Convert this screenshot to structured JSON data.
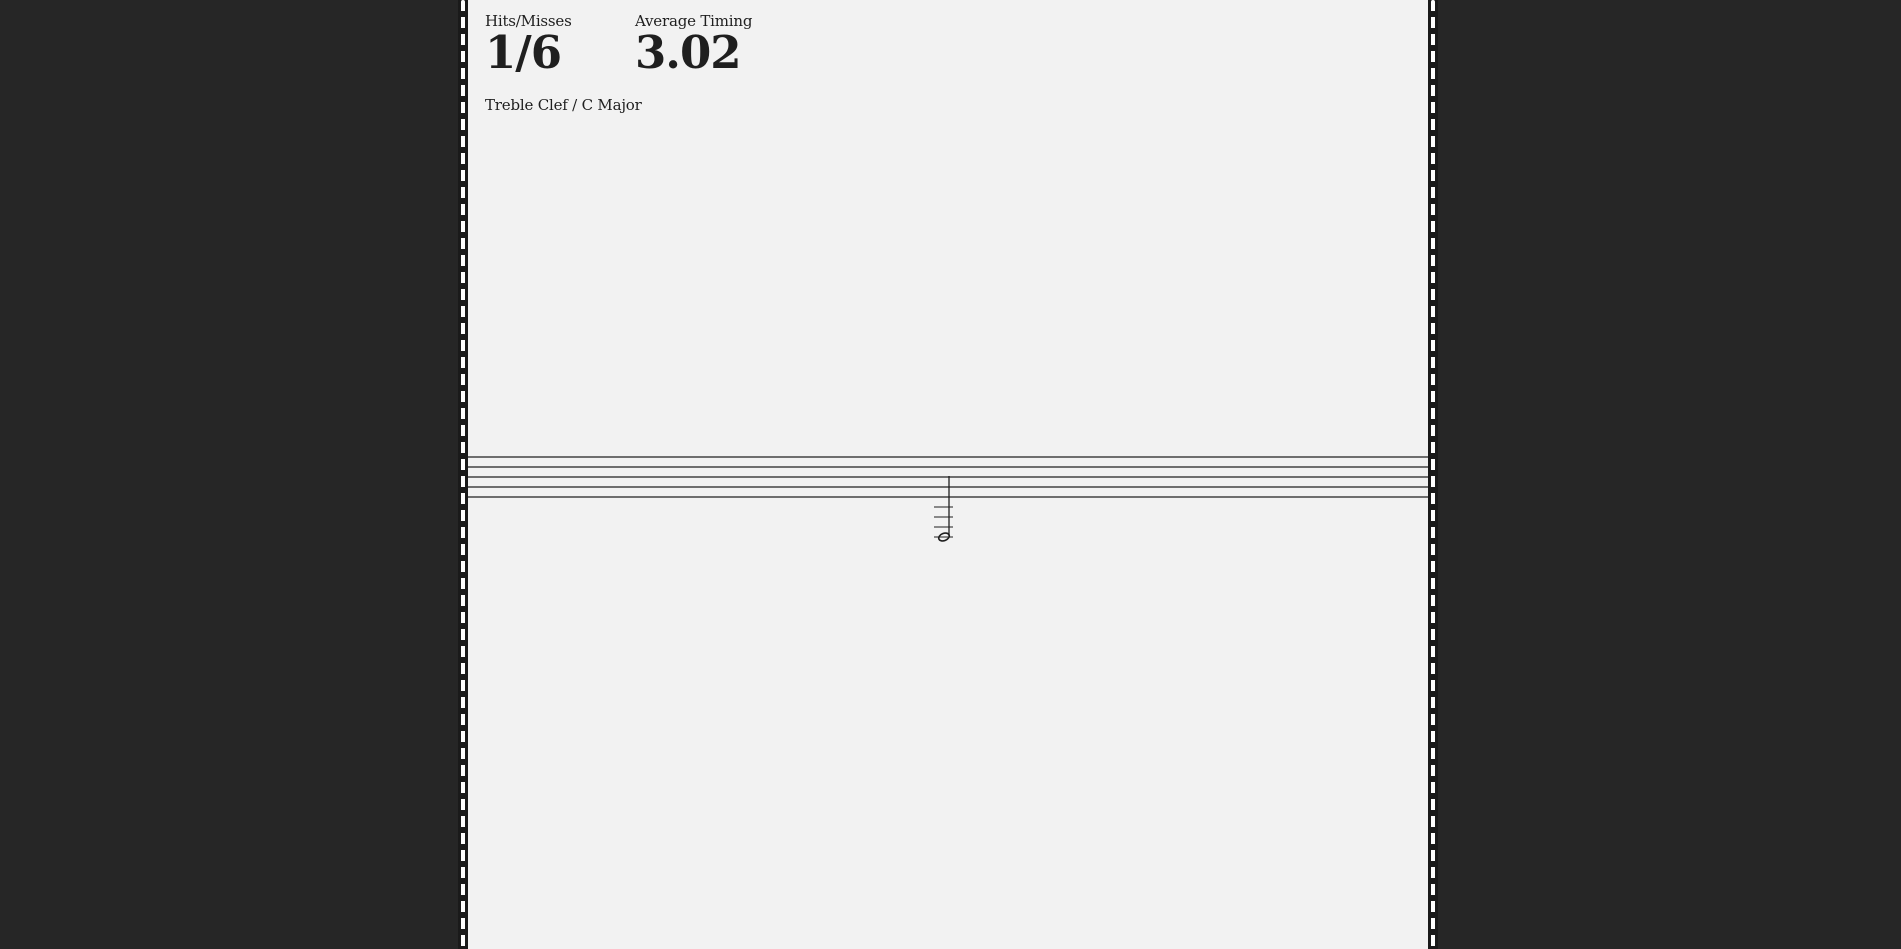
{
  "stats": {
    "hits_misses_label": "Hits/Misses",
    "hits_misses_value": "1/6",
    "average_timing_label": "Average Timing",
    "average_timing_value": "3.02"
  },
  "mode": {
    "label": "Treble Clef / C Major"
  },
  "staff": {
    "line_count": 5,
    "current_note": "half note on ledger lines below staff",
    "ledger_line_count": 4
  },
  "colors": {
    "background": "#262626",
    "panel": "#f2f2f2",
    "ink": "#1f1f1f",
    "rail_dash": "#ffffff"
  }
}
